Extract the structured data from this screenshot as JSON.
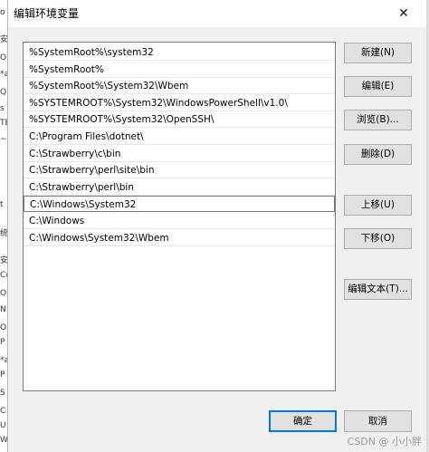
{
  "dialog": {
    "title": "编辑环境变量",
    "close_glyph": "✕"
  },
  "background_fragments": [
    "o",
    "安",
    "O",
    "*a",
    "Q",
    "s",
    "TE",
    "~",
    "t",
    "统",
    "安",
    "Co",
    "O",
    "N",
    "O",
    "P",
    "*a",
    "P",
    "S",
    "C",
    "U",
    "W"
  ],
  "path_entries": [
    "%SystemRoot%\\system32",
    "%SystemRoot%",
    "%SystemRoot%\\System32\\Wbem",
    "%SYSTEMROOT%\\System32\\WindowsPowerShell\\v1.0\\",
    "%SYSTEMROOT%\\System32\\OpenSSH\\",
    "C:\\Program Files\\dotnet\\",
    "C:\\Strawberry\\c\\bin",
    "C:\\Strawberry\\perl\\site\\bin",
    "C:\\Strawberry\\perl\\bin",
    "C:\\Windows\\System32",
    "C:\\Windows",
    "C:\\Windows\\System32\\Wbem"
  ],
  "selected_index": 9,
  "buttons": {
    "new": "新建(N)",
    "edit": "编辑(E)",
    "browse": "浏览(B)...",
    "delete": "删除(D)",
    "move_up": "上移(U)",
    "move_down": "下移(O)",
    "edit_text": "编辑文本(T)..."
  },
  "footer": {
    "ok": "确定",
    "cancel": "取消"
  },
  "watermark": "CSDN @ 小小胖"
}
